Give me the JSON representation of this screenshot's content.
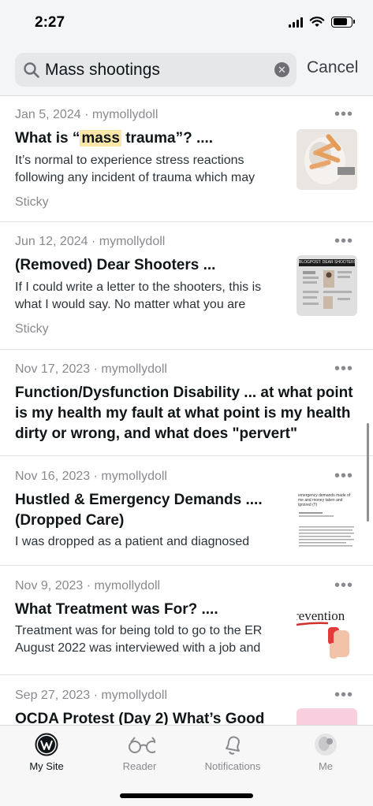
{
  "status": {
    "time": "2:27"
  },
  "search": {
    "value": "Mass shootings",
    "cancel_label": "Cancel"
  },
  "posts": [
    {
      "date": "Jan 5, 2024",
      "author": "mymollydoll",
      "title_prefix": "What is “",
      "title_highlight": "mass",
      "title_suffix": " trauma”? ....",
      "excerpt": "It’s normal to experience stress reactions following any incident of trauma which may",
      "tag": "Sticky",
      "has_thumbnail": true
    },
    {
      "date": "Jun 12, 2024",
      "author": "mymollydoll",
      "title": "(Removed) Dear Shooters ...",
      "excerpt": "If I could write a letter to the shooters, this is what I would say. No matter what you are",
      "tag": "Sticky",
      "thumbnail_text": "BLOGPOST: DEAR SHOOTERS ...",
      "has_thumbnail": true
    },
    {
      "date": "Nov 17, 2023",
      "author": "mymollydoll",
      "title": "Function/Dysfunction Disability ... at what point is my health my fault at what point is my health dirty or wrong, and what does \"pervert\"",
      "has_thumbnail": false
    },
    {
      "date": "Nov 16, 2023",
      "author": "mymollydoll",
      "title": "Hustled & Emergency Demands .... (Dropped Care)",
      "excerpt": "I was dropped as a patient and diagnosed",
      "thumbnail_text": "emergency demands made of me and money taken and ignored (!!)",
      "has_thumbnail": true
    },
    {
      "date": "Nov 9, 2023",
      "author": "mymollydoll",
      "title": "What Treatment was For? ....",
      "excerpt": "Treatment was for being told to go to the ER August 2022 was interviewed with a job and",
      "thumbnail_text": "revention",
      "has_thumbnail": true
    },
    {
      "date": "Sep 27, 2023",
      "author": "mymollydoll",
      "title": "OCDA Protest (Day 2) What’s Good",
      "has_thumbnail": true
    }
  ],
  "tabs": [
    {
      "label": "My Site",
      "icon": "wordpress-icon",
      "active": true
    },
    {
      "label": "Reader",
      "icon": "glasses-icon",
      "active": false
    },
    {
      "label": "Notifications",
      "icon": "bell-icon",
      "active": false
    },
    {
      "label": "Me",
      "icon": "avatar",
      "active": false
    }
  ],
  "colors": {
    "highlight": "#fbe7a8",
    "text": "#101517",
    "muted": "#8a8a8e"
  }
}
